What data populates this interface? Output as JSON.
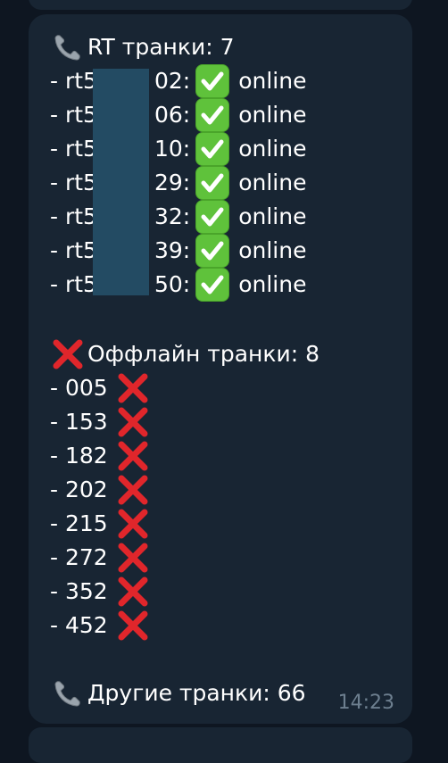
{
  "message": {
    "rt_header": "RT транки: 7",
    "rt_lines": [
      {
        "name_left": "- rt5",
        "name_right": "02:",
        "status": "online"
      },
      {
        "name_left": "- rt5",
        "name_right": "06:",
        "status": "online"
      },
      {
        "name_left": "- rt5",
        "name_right": "10:",
        "status": "online"
      },
      {
        "name_left": "- rt5",
        "name_right": "29:",
        "status": "online"
      },
      {
        "name_left": "- rt5",
        "name_right": "32:",
        "status": "online"
      },
      {
        "name_left": "- rt5",
        "name_right": "39:",
        "status": "online"
      },
      {
        "name_left": "- rt5",
        "name_right": "50:",
        "status": "online"
      }
    ],
    "offline_header": "Оффлайн транки: 8",
    "offline_lines": [
      "- 005",
      "- 153",
      "- 182",
      "- 202",
      "- 215",
      "- 272",
      "- 352",
      "- 452"
    ],
    "other_header": "Другие транки: 66",
    "time": "14:23"
  },
  "icons": {
    "phone": "telephone-receiver-icon",
    "check": "check-mark-button-icon",
    "cross": "cross-mark-icon"
  },
  "colors": {
    "background": "#0e1621",
    "bubble": "#182533",
    "check_green": "#5fc23b",
    "cross_red": "#e0262b",
    "time_text": "#6d7f8f",
    "redaction": "#234b63"
  }
}
